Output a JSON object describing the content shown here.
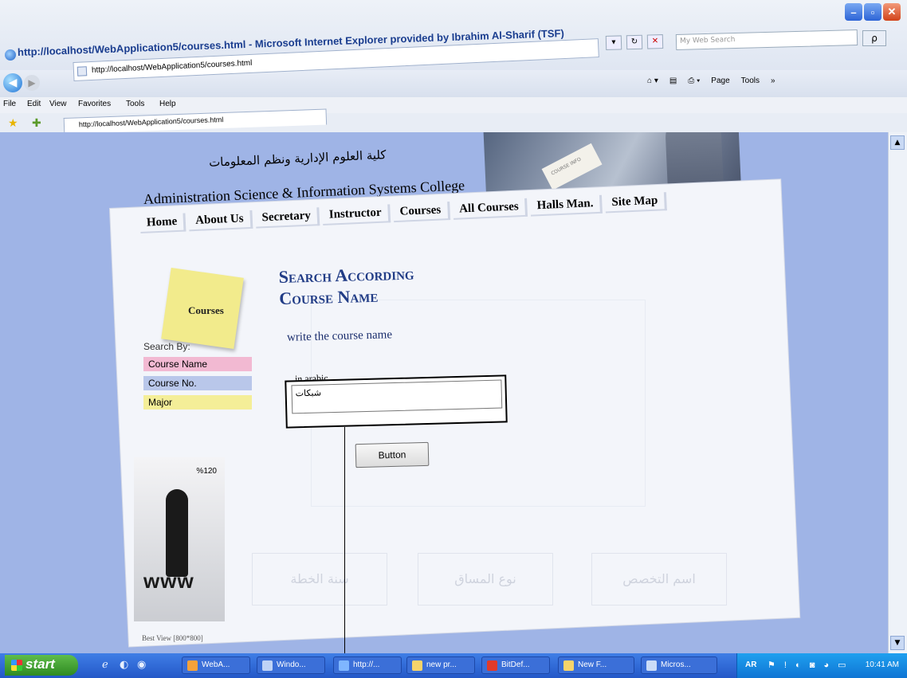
{
  "window": {
    "title": "http://localhost/WebApplication5/courses.html - Microsoft Internet Explorer provided by Ibrahim Al-Sharif (TSF)",
    "min_symbol": "–",
    "max_symbol": "▫",
    "close_symbol": "✕",
    "search_placeholder": "My Web Search",
    "search_go": "ρ"
  },
  "address_bar": {
    "url": "http://localhost/WebApplication5/courses.html"
  },
  "command_bar": {
    "page_label": "Page",
    "tools_label": "Tools"
  },
  "menubar": [
    "File",
    "Edit",
    "View",
    "Favorites",
    "Tools",
    "Help"
  ],
  "tab": {
    "title": "http://localhost/WebApplication5/courses.html"
  },
  "header": {
    "arabic_title": "كلية العلوم الإدارية ونظم المعلومات",
    "english_title": "Administration Science & Information Systems College",
    "photo_paper_text": "COURSE INFO"
  },
  "site_menu": [
    "Home",
    "About Us",
    "Secretary",
    "Instructor",
    "Courses",
    "All Courses",
    "Halls Man.",
    "Site Map"
  ],
  "sidebar": {
    "sticky_label": "Courses",
    "search_by_label": "Search By:",
    "options": [
      "Course Name",
      "Course No.",
      "Major"
    ],
    "ad_percent": "%120",
    "ad_text": "www",
    "best_view": "Best View [800*800]"
  },
  "main": {
    "heading_line1": "Search According",
    "heading_line2": "Course Name",
    "instruction": "write the course name",
    "field_label": "in arabic",
    "field_value": "شبكات",
    "button_label": "Button"
  },
  "ghost_labels": [
    "اسم التخصص",
    "نوع المساق",
    "سنة الخطة"
  ],
  "taskbar": {
    "start_label": "start",
    "tasks": [
      "WebA...",
      "Windo...",
      "http://...",
      "new pr...",
      "BitDef...",
      "New F...",
      "Micros..."
    ],
    "lang": "AR",
    "clock": "10:41 AM"
  },
  "colors": {
    "page_bg": "#9fb4e6",
    "heading": "#213c86",
    "opt_course_name": "#f2b9d2",
    "opt_course_no": "#b9c7ea",
    "opt_major": "#f4ee98",
    "sticky": "#f2eb8c"
  }
}
